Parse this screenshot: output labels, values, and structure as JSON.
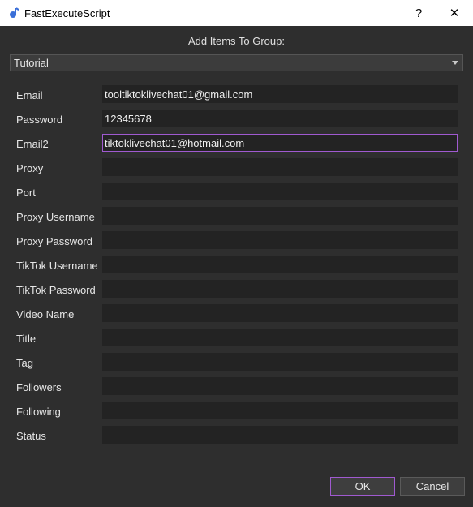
{
  "window": {
    "title": "FastExecuteScript",
    "help_label": "?",
    "close_label": "✕"
  },
  "header": "Add Items To Group:",
  "group_select": {
    "value": "Tutorial"
  },
  "fields": [
    {
      "label": "Email",
      "value": "tooltiktoklivechat01@gmail.com"
    },
    {
      "label": "Password",
      "value": "12345678"
    },
    {
      "label": "Email2",
      "value": "tiktoklivechat01@hotmail.com"
    },
    {
      "label": "Proxy",
      "value": ""
    },
    {
      "label": "Port",
      "value": ""
    },
    {
      "label": "Proxy Username",
      "value": ""
    },
    {
      "label": "Proxy Password",
      "value": ""
    },
    {
      "label": "TikTok Username",
      "value": ""
    },
    {
      "label": "TikTok Password",
      "value": ""
    },
    {
      "label": "Video Name",
      "value": ""
    },
    {
      "label": "Title",
      "value": ""
    },
    {
      "label": "Tag",
      "value": ""
    },
    {
      "label": "Followers",
      "value": ""
    },
    {
      "label": "Following",
      "value": ""
    },
    {
      "label": "Status",
      "value": ""
    }
  ],
  "buttons": {
    "ok": "OK",
    "cancel": "Cancel"
  },
  "colors": {
    "background": "#2e2e2e",
    "field": "#232323",
    "accent": "#a05ad0"
  }
}
